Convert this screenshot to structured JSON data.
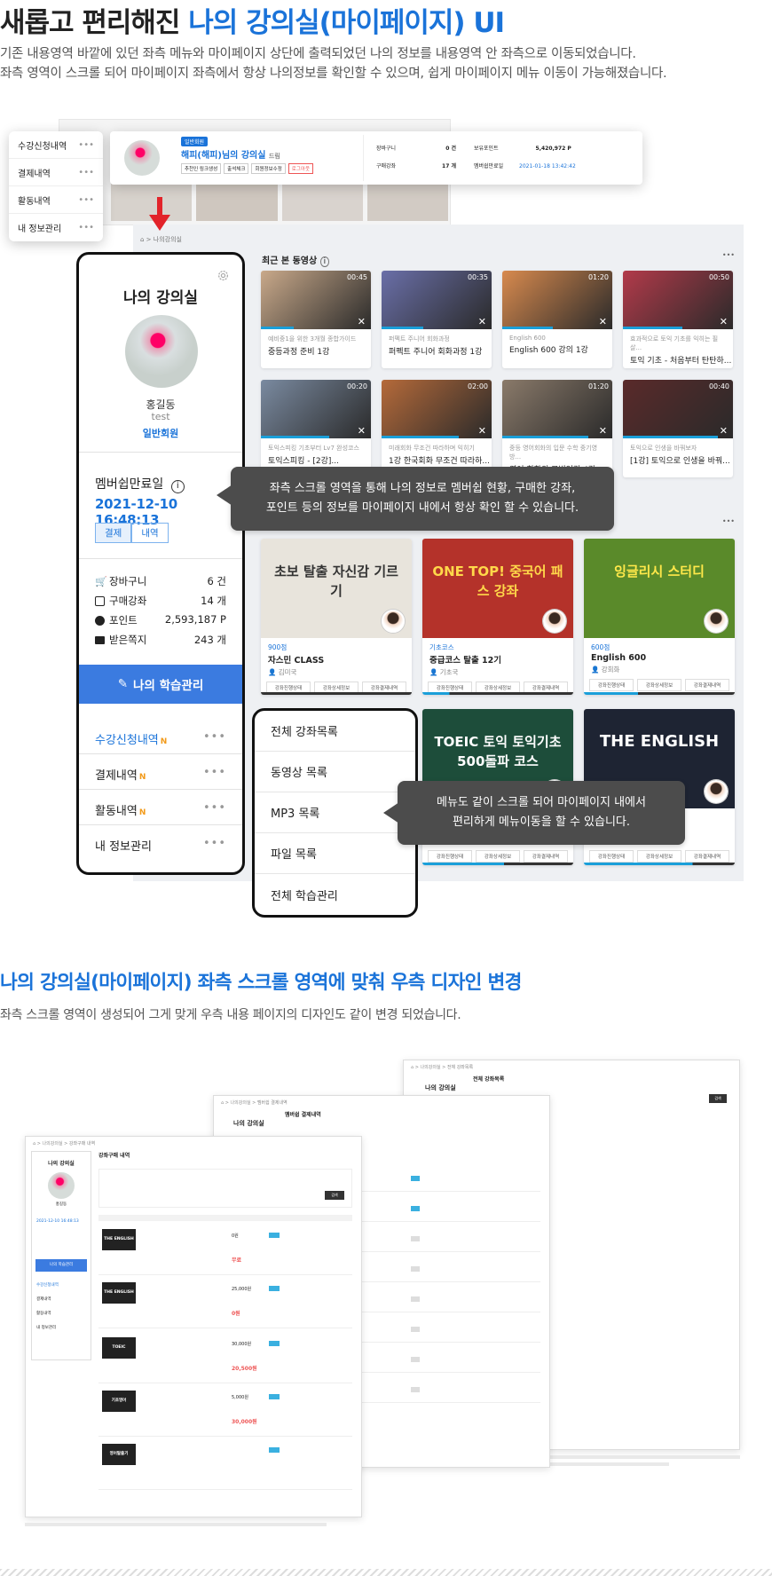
{
  "header": {
    "title_prefix": "새롭고 편리해진 ",
    "title_highlight": "나의 강의실(마이페이지) UI",
    "desc_line1": "기존 내용영역 바깥에 있던 좌측 메뉴와 마이페이지 상단에 출력되었던 나의 정보를 내용영역 안 좌측으로 이동되었습니다.",
    "desc_line2": "좌측 영역이 스크롤 되어 마이페이지 좌측에서 항상 나의정보를 확인할 수 있으며, 쉽게 마이페이지 메뉴 이동이 가능해졌습니다."
  },
  "old_ui": {
    "menu": [
      "수강신청내역",
      "결제내역",
      "활동내역",
      "내 정보관리"
    ],
    "badge": "일반회원",
    "name_line": "해피(해피)님의 강의실",
    "grade_suffix": "드림",
    "buttons": [
      "추천인 링크생성",
      "출석체크",
      "회원정보수정",
      "로그아웃"
    ],
    "stats": [
      {
        "label": "장바구니",
        "value": "0 건"
      },
      {
        "label": "구매강좌",
        "value": "17 개"
      }
    ],
    "points_label": "보유포인트",
    "points_value": "5,420,972 P",
    "expire_label": "멤버쉽만료일",
    "expire_value": "2021-01-18 13:42:42"
  },
  "left_card": {
    "title": "나의 강의실",
    "name": "홍길동",
    "id": "test",
    "grade": "일반회원",
    "membership_label": "멤버쉽만료일",
    "membership_date": "2021-12-10 16:48:13",
    "btn_pay": "결제",
    "btn_history": "내역",
    "stats": [
      {
        "label": "장바구니",
        "value": "6 건"
      },
      {
        "label": "구매강좌",
        "value": "14 개"
      },
      {
        "label": "포인트",
        "value": "2,593,187 P"
      },
      {
        "label": "받은쪽지",
        "value": "243 개"
      }
    ],
    "learn_button": "나의 학습관리",
    "menu": [
      {
        "label": "수강신청내역",
        "badge": "N"
      },
      {
        "label": "결제내역",
        "badge": "N"
      },
      {
        "label": "활동내역",
        "badge": "N"
      },
      {
        "label": "내 정보관리",
        "badge": ""
      }
    ],
    "menu_more": "•••"
  },
  "breadcrumb": "나의강의실",
  "recent": {
    "title": "최근 본 동영상",
    "more": "•••",
    "videos": [
      {
        "dur": "00:45",
        "sub": "예비중1을 위한 3개월 종합가이드",
        "title": "중등과정 준비 1강",
        "color": "#c9a98a"
      },
      {
        "dur": "00:35",
        "sub": "퍼펙트 주니어 회화과정",
        "title": "퍼펙트 주니어 회화과정 1강",
        "color": "#6a6fa8"
      },
      {
        "dur": "01:20",
        "sub": "English 600",
        "title": "English 600 강의 1강",
        "color": "#d88a4e"
      },
      {
        "dur": "00:50",
        "sub": "효과적으로 토익 기초를 익히는 필살...",
        "title": "토익 기초 - 처음부터 탄탄하...",
        "color": "#b23a4a"
      },
      {
        "dur": "00:20",
        "sub": "토익스피킹 기초부터 Lv7 완성코스",
        "title": "토익스피킹 - [2강]...",
        "color": "#7a8aa0"
      },
      {
        "dur": "02:00",
        "sub": "미래회화 무조건 따라하며 익히기",
        "title": "1강 한국회화 무조건 따라하...",
        "color": "#b56a3a"
      },
      {
        "dur": "01:20",
        "sub": "중등 영어회화의 입문 수학 중기영방...",
        "title": "영어 회화의 모범인강 4강",
        "color": "#8a7a6a"
      },
      {
        "dur": "00:40",
        "sub": "토익으로 인생을 바꿔보자",
        "title": "[1강] 토익으로 인생을 바꿔...",
        "color": "#5a2a2a"
      }
    ]
  },
  "tooltip1": {
    "line1": "좌측 스크롤 영역을 통해 나의 정보로 멤버쉽 현황, 구매한 강좌,",
    "line2": "포인트 등의 정보를 마이페이지 내에서 항상 확인 할 수 있습니다."
  },
  "courses": [
    {
      "cat": "900점",
      "title": "자스민 CLASS",
      "teacher": "김미국",
      "img_text": "초보 탈출 자신감 기르기",
      "bg": "#e8e4dc",
      "fg": "#333"
    },
    {
      "cat": "기초코스",
      "title": "중급코스 탈출 12기",
      "teacher": "기초국",
      "img_text": "ONE TOP! 중국어 패스 강좌",
      "bg": "#b4322a",
      "fg": "#ffd84a"
    },
    {
      "cat": "600점",
      "title": "English 600",
      "teacher": "강회화",
      "img_text": "잉글리시 스터디",
      "bg": "#5a8a2a",
      "fg": "#ffe84a"
    },
    {
      "cat": "",
      "title": "",
      "teacher": "",
      "img_text": "TOEIC 토익 토익기초 500돌파 코스",
      "bg": "#1d4d3a",
      "fg": "#fff"
    },
    {
      "cat": "",
      "title": "",
      "teacher": "",
      "img_text": "THE ENGLISH",
      "bg": "#1e2433",
      "fg": "#fff"
    }
  ],
  "course_buttons": [
    "강좌진행상태",
    "강좌상세정보",
    "강좌결제내역"
  ],
  "submenu": [
    "전체 강좌목록",
    "동영상 목록",
    "MP3 목록",
    "파일 목록",
    "전체 학습관리"
  ],
  "tooltip2": {
    "line1": "메뉴도 같이 스크롤 되어 마이페이지 내에서",
    "line2": "편리하게 메뉴이동을 할 수 있습니다."
  },
  "section2": {
    "title": "나의 강의실(마이페이지) 좌측 스크롤 영역에 맞춰 우측 디자인 변경",
    "desc": "좌측 스크롤 영역이 생성되어 그게 맞게 우측 내용 페이지의 디자인도 같이 변경 되었습니다."
  },
  "mini": {
    "title": "나의 강의실",
    "name": "홍길동",
    "date": "2021-12-10 16:48:13",
    "learn": "나의 학습관리",
    "menu": [
      "수강신청내역",
      "결제내역",
      "활동내역",
      "내 정보관리"
    ],
    "page1": "강좌구매 내역",
    "page2": "멤버쉽 결제내역",
    "page3": "전체 강좌목록",
    "prices": [
      "0원",
      "무료",
      "25,000원",
      "0원",
      "30,000원",
      "20,500원",
      "5,000원",
      "30,000원"
    ],
    "thumb_labels": [
      "THE ENGLISH",
      "THE ENGLISH",
      "TOEIC",
      "기초영어",
      "영어탈출기"
    ]
  }
}
